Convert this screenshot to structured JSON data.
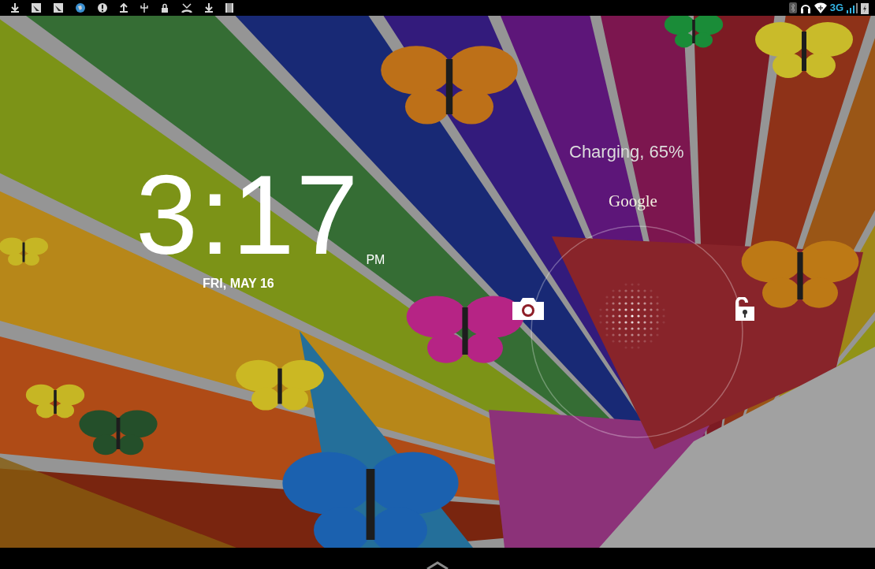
{
  "status_bar": {
    "network": "3G"
  },
  "clock": {
    "time": "3:17",
    "ampm": "PM",
    "date": "FRI, MAY 16"
  },
  "unlock": {
    "status": "Charging, 65%",
    "search_label": "Google"
  }
}
